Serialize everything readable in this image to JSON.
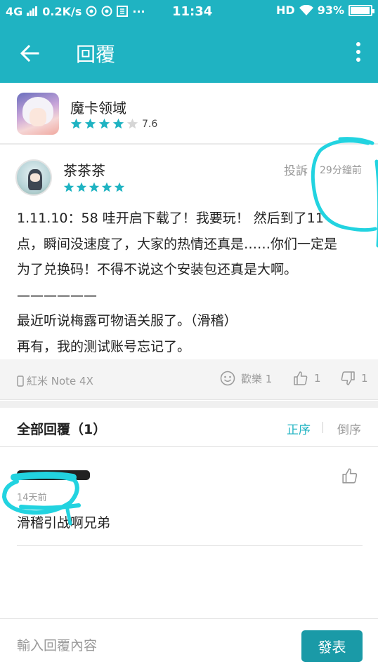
{
  "status_bar": {
    "network": "4G",
    "speed": "0.2K/s",
    "time": "11:34",
    "hd": "HD",
    "battery": "93%"
  },
  "app_bar": {
    "title": "回覆",
    "back_icon": "arrow-left-icon",
    "more_icon": "more-vertical-icon"
  },
  "game": {
    "name": "魔卡领域",
    "rating": "7.6",
    "stars_filled": 4,
    "stars_total": 5
  },
  "review": {
    "author": "茶茶茶",
    "stars_filled": 5,
    "report_label": "投訴",
    "time": "29分鐘前",
    "lines": [
      "1.11.10：58 哇开启下载了！我要玩！ 然后到了11",
      "点，瞬间没速度了，大家的热情还真是……你们一定是",
      "为了兑换码！不得不说这个安装包还真是大啊。",
      "——————",
      "最近听说梅露可物语关服了。（滑稽）",
      "再有，我的测试账号忘记了。"
    ],
    "device": "紅米 Note 4X",
    "fun_label": "歡樂 1",
    "likes": "1",
    "dislikes": "1"
  },
  "replies_header": {
    "title": "全部回覆（1）",
    "sort_asc": "正序",
    "sort_desc": "倒序"
  },
  "replies": [
    {
      "time": "14天前",
      "text": "滑稽引战啊兄弟"
    }
  ],
  "input": {
    "placeholder": "輸入回覆內容",
    "send_label": "發表"
  },
  "colors": {
    "accent": "#1fb3c2",
    "send_button": "#1a9aa7",
    "annotation": "#22d3e0"
  }
}
